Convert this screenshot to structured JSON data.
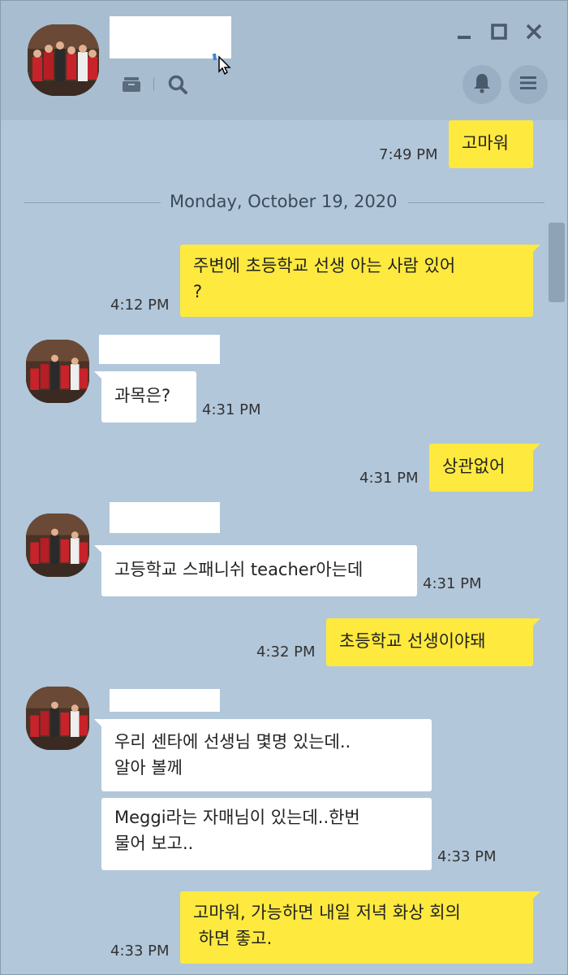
{
  "header": {
    "archive_icon": "archive-icon",
    "search_icon": "search-icon",
    "bell_icon": "bell-icon",
    "menu_icon": "menu-icon"
  },
  "date_divider": "Monday, October 19, 2020",
  "messages": [
    {
      "side": "me",
      "text": "고마워",
      "time": "7:49 PM"
    },
    {
      "side": "me",
      "text": "주변에 초등학교 선생 아는 사람 있어?",
      "time": "4:12 PM"
    },
    {
      "side": "them",
      "text": "과목은?",
      "time": "4:31 PM"
    },
    {
      "side": "me",
      "text": "상관없어",
      "time": "4:31 PM"
    },
    {
      "side": "them",
      "text": "고등학교 스패니쉬 teacher아는데",
      "time": "4:31 PM"
    },
    {
      "side": "me",
      "text": "초등학교 선생이야돼",
      "time": "4:32 PM"
    },
    {
      "side": "them",
      "text": "우리 센타에 선생님 몇명 있는데..알아 볼께",
      "time": ""
    },
    {
      "side": "them",
      "text": "Meggi라는 자매님이 있는데..한번 물어 보고..",
      "time": "4:33 PM"
    },
    {
      "side": "me",
      "text": "고마워, 가능하면 내일 저녁 화상 회의 하면 좋고.",
      "time": "4:33 PM"
    }
  ],
  "display": {
    "m2_line1": "주변에 초등학교 선생 아는 사람 있어",
    "m2_line2": "?",
    "m7_line1": "우리 센타에 선생님 몇명 있는데..",
    "m7_line2": "알아 볼께",
    "m8_line1": "Meggi라는 자매님이 있는데..한번",
    "m8_line2": "물어 보고..",
    "m9_line1": "고마워, 가능하면 내일 저녁 화상 회의",
    "m9_line2": " 하면 좋고."
  }
}
